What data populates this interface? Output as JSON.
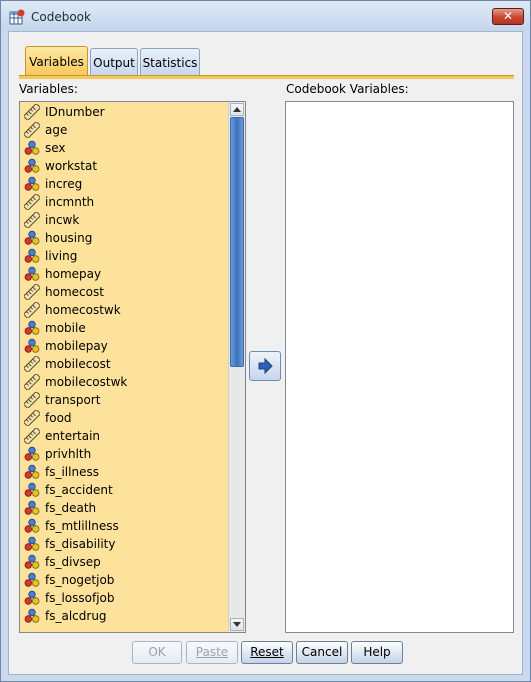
{
  "window": {
    "title": "Codebook",
    "close_label": "✕"
  },
  "tabs": [
    {
      "label": "Variables",
      "active": true
    },
    {
      "label": "Output",
      "active": false
    },
    {
      "label": "Statistics",
      "active": false
    }
  ],
  "variables_label": "Variables:",
  "codebook_variables_label": "Codebook Variables:",
  "variables": [
    {
      "name": "IDnumber",
      "icon": "scale-ruler-icon"
    },
    {
      "name": "age",
      "icon": "scale-ruler-icon"
    },
    {
      "name": "sex",
      "icon": "nominal-icon"
    },
    {
      "name": "workstat",
      "icon": "nominal-icon"
    },
    {
      "name": "increg",
      "icon": "nominal-icon"
    },
    {
      "name": "incmnth",
      "icon": "scale-ruler-icon"
    },
    {
      "name": "incwk",
      "icon": "scale-ruler-icon"
    },
    {
      "name": "housing",
      "icon": "nominal-icon"
    },
    {
      "name": "living",
      "icon": "nominal-icon"
    },
    {
      "name": "homepay",
      "icon": "nominal-icon"
    },
    {
      "name": "homecost",
      "icon": "scale-ruler-icon"
    },
    {
      "name": "homecostwk",
      "icon": "scale-ruler-icon"
    },
    {
      "name": "mobile",
      "icon": "nominal-icon"
    },
    {
      "name": "mobilepay",
      "icon": "nominal-icon"
    },
    {
      "name": "mobilecost",
      "icon": "scale-ruler-icon"
    },
    {
      "name": "mobilecostwk",
      "icon": "scale-ruler-icon"
    },
    {
      "name": "transport",
      "icon": "scale-ruler-icon"
    },
    {
      "name": "food",
      "icon": "scale-ruler-icon"
    },
    {
      "name": "entertain",
      "icon": "scale-ruler-icon"
    },
    {
      "name": "privhlth",
      "icon": "nominal-icon"
    },
    {
      "name": "fs_illness",
      "icon": "nominal-icon"
    },
    {
      "name": "fs_accident",
      "icon": "nominal-icon"
    },
    {
      "name": "fs_death",
      "icon": "nominal-icon"
    },
    {
      "name": "fs_mtlillness",
      "icon": "nominal-icon"
    },
    {
      "name": "fs_disability",
      "icon": "nominal-icon"
    },
    {
      "name": "fs_divsep",
      "icon": "nominal-icon"
    },
    {
      "name": "fs_nogetjob",
      "icon": "nominal-icon"
    },
    {
      "name": "fs_lossofjob",
      "icon": "nominal-icon"
    },
    {
      "name": "fs_alcdrug",
      "icon": "nominal-icon"
    }
  ],
  "codebook_variables": [],
  "move_button_icon": "arrow-right-icon",
  "buttons": {
    "ok": "OK",
    "paste": "Paste",
    "reset": "Reset",
    "cancel": "Cancel",
    "help": "Help"
  },
  "colors": {
    "list_bg": "#fce29a",
    "active_tab": "#f7c75b",
    "scroll_thumb": "#3a73c0"
  }
}
